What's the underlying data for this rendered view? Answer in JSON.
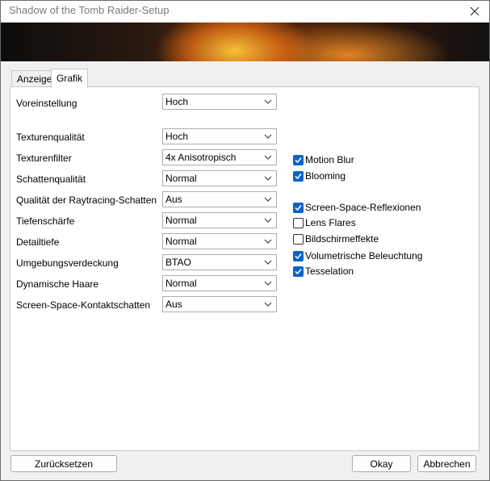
{
  "window": {
    "title": "Shadow of the Tomb Raider-Setup"
  },
  "tabs": [
    {
      "label": "Anzeige",
      "active": false
    },
    {
      "label": "Grafik",
      "active": true
    }
  ],
  "settings": {
    "preset": {
      "label": "Voreinstellung",
      "value": "Hoch"
    },
    "rows": [
      {
        "label": "Texturenqualität",
        "value": "Hoch"
      },
      {
        "label": "Texturenfilter",
        "value": "4x Anisotropisch"
      },
      {
        "label": "Schattenqualität",
        "value": "Normal"
      },
      {
        "label": "Qualität der Raytracing-Schatten",
        "value": "Aus"
      },
      {
        "label": "Tiefenschärfe",
        "value": "Normal"
      },
      {
        "label": "Detailtiefe",
        "value": "Normal"
      },
      {
        "label": "Umgebungsverdeckung",
        "value": "BTAO"
      },
      {
        "label": "Dynamische Haare",
        "value": "Normal"
      },
      {
        "label": "Screen-Space-Kontaktschatten",
        "value": "Aus"
      }
    ]
  },
  "checkboxes": [
    {
      "label": "Motion Blur",
      "checked": true
    },
    {
      "label": "Blooming",
      "checked": true
    },
    {
      "label": "Screen-Space-Reflexionen",
      "checked": true
    },
    {
      "label": "Lens Flares",
      "checked": false
    },
    {
      "label": "Bildschirmeffekte",
      "checked": false
    },
    {
      "label": "Volumetrische Beleuchtung",
      "checked": true
    },
    {
      "label": "Tesselation",
      "checked": true
    }
  ],
  "buttons": {
    "reset": "Zurücksetzen",
    "ok": "Okay",
    "cancel": "Abbrechen"
  },
  "colors": {
    "checkbox_accent": "#0e63c9"
  },
  "icons": {
    "close": "close-icon",
    "dropdown": "chevron-down-icon",
    "check": "check-icon"
  }
}
